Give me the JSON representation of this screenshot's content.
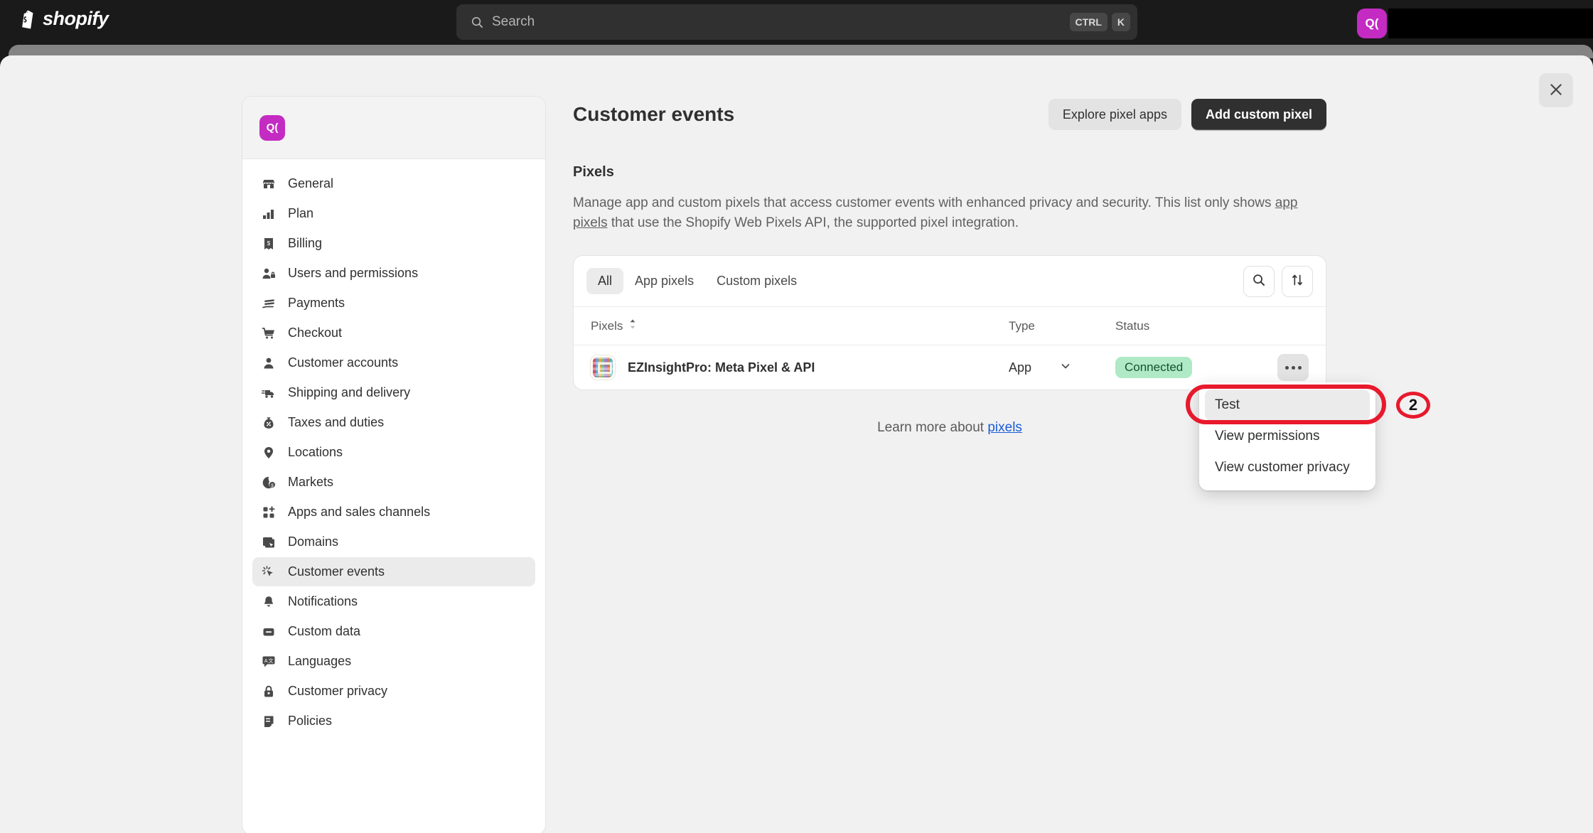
{
  "topbar": {
    "logo_text": "shopify",
    "logo_icon": "shopify-bag-icon",
    "search": {
      "icon": "search-icon",
      "placeholder": "Search",
      "value": "",
      "kbd_ctrl": "CTRL",
      "kbd_key": "K"
    },
    "notifications_icon": "bell-icon",
    "avatar_initials": "Q(",
    "avatar_color": "#c32bc3",
    "store_name": ""
  },
  "sheet": {
    "close_icon": "close-icon",
    "strip_color": "#848484",
    "background": "#f1f1f1"
  },
  "settings_nav": {
    "avatar_initials": "Q(",
    "store_name": "",
    "items": [
      {
        "label": "General",
        "icon": "store-icon",
        "active": false
      },
      {
        "label": "Plan",
        "icon": "chart-bar-icon",
        "active": false
      },
      {
        "label": "Billing",
        "icon": "receipt-dollar-icon",
        "active": false
      },
      {
        "label": "Users and permissions",
        "icon": "person-lock-icon",
        "active": false
      },
      {
        "label": "Payments",
        "icon": "payment-card-icon",
        "active": false
      },
      {
        "label": "Checkout",
        "icon": "cart-icon",
        "active": false
      },
      {
        "label": "Customer accounts",
        "icon": "person-icon",
        "active": false
      },
      {
        "label": "Shipping and delivery",
        "icon": "delivery-truck-icon",
        "active": false
      },
      {
        "label": "Taxes and duties",
        "icon": "money-bag-percent-icon",
        "active": false
      },
      {
        "label": "Locations",
        "icon": "location-pin-icon",
        "active": false
      },
      {
        "label": "Markets",
        "icon": "globe-dollar-icon",
        "active": false
      },
      {
        "label": "Apps and sales channels",
        "icon": "apps-plus-icon",
        "active": false
      },
      {
        "label": "Domains",
        "icon": "domains-icon",
        "active": false
      },
      {
        "label": "Customer events",
        "icon": "customer-events-icon",
        "active": true
      },
      {
        "label": "Notifications",
        "icon": "bell-icon",
        "active": false
      },
      {
        "label": "Custom data",
        "icon": "database-icon",
        "active": false
      },
      {
        "label": "Languages",
        "icon": "languages-icon",
        "active": false
      },
      {
        "label": "Customer privacy",
        "icon": "lock-icon",
        "active": false
      },
      {
        "label": "Policies",
        "icon": "policies-icon",
        "active": false
      }
    ]
  },
  "main": {
    "page_title": "Customer events",
    "explore_button": "Explore pixel apps",
    "add_button": "Add custom pixel",
    "section_title": "Pixels",
    "description_part1": "Manage app and custom pixels that access customer events with enhanced privacy and security. This list only shows ",
    "description_link": "app pixels",
    "description_part2": " that use the Shopify Web Pixels API, the supported pixel integration.",
    "tabs": [
      {
        "label": "All",
        "active": true
      },
      {
        "label": "App pixels",
        "active": false
      },
      {
        "label": "Custom pixels",
        "active": false
      }
    ],
    "search_icon": "search-icon",
    "sort_icon": "sort-arrows-icon",
    "table": {
      "columns": [
        "Pixels",
        "Type",
        "Status"
      ],
      "sort_indicator_icon": "sort-chevrons-icon",
      "rows": [
        {
          "icon": "app-thumbnail-icon",
          "name": "EZInsightPro: Meta Pixel & API",
          "type": "App",
          "type_chevron_icon": "chevron-down-icon",
          "status": "Connected",
          "status_color": "#afe9c6",
          "actions_icon": "ellipsis-icon"
        }
      ]
    },
    "learn_more_prefix": "Learn more about ",
    "learn_more_link": "pixels"
  },
  "popover": {
    "items": [
      {
        "label": "Test",
        "hovered": true
      },
      {
        "label": "View permissions",
        "hovered": false
      },
      {
        "label": "View customer privacy",
        "hovered": false
      }
    ]
  },
  "annotation": {
    "number": "2",
    "color": "#e8192c"
  }
}
